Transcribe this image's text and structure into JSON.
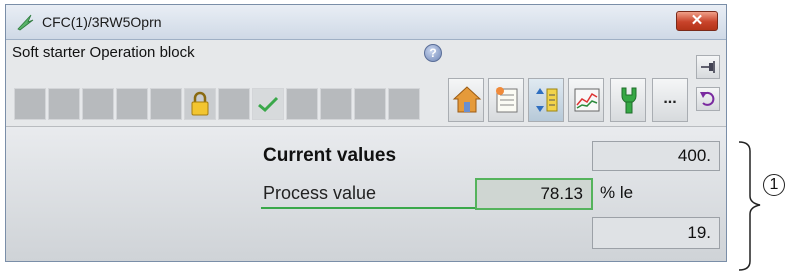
{
  "window": {
    "title": "CFC(1)/3RW5Oprn",
    "close_symbol": "✕"
  },
  "block": {
    "label": "Soft starter Operation block"
  },
  "icons": {
    "app": "pen-icon",
    "help": "help-icon",
    "lock": "lock-icon",
    "check": "checkmark-icon",
    "toolbar": [
      "home-icon",
      "notes-icon",
      "parameter-icon",
      "trend-icon",
      "maintenance-icon"
    ],
    "side": [
      "pin-icon",
      "undo-icon"
    ]
  },
  "help_symbol": "?",
  "more_label": "...",
  "current_values": {
    "label": "Current values",
    "value": "400.",
    "process_label": "Process value",
    "process_value": "78.13",
    "process_unit": "% le",
    "second_value": "19."
  },
  "callout": {
    "label": "1"
  },
  "colors": {
    "green": "#3aa84a",
    "close_red": "#c8432a",
    "titlebar": "#cfd9e6"
  }
}
